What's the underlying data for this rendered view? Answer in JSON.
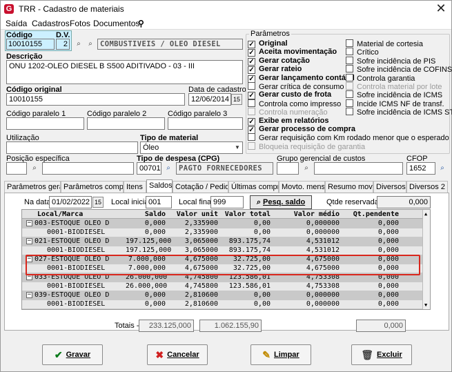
{
  "window": {
    "title": "TRR - Cadastro de materiais"
  },
  "menu": [
    "Saída",
    "Cadastros",
    "Fotos",
    "Documentos"
  ],
  "fields": {
    "codigo_label": "Código",
    "dv_label": "D.V.",
    "codigo": "10010155",
    "dv": "2",
    "grupo": "COMBUSTIVEIS / OLEO DIESEL",
    "descricao_label": "Descrição",
    "descricao": "ONU 1202-OLEO DIESEL B S500 ADITIVADO - 03 - III",
    "codigo_original_label": "Código original",
    "codigo_original": "10010155",
    "data_cadastro_label": "Data de cadastro",
    "data_cadastro": "12/06/2014",
    "cod_par1_label": "Código paralelo 1",
    "cod_par2_label": "Código paralelo 2",
    "cod_par3_label": "Código paralelo 3",
    "utilizacao_label": "Utilização",
    "tipo_material_label": "Tipo de material",
    "tipo_material": "Óleo",
    "posicao_label": "Posição específica",
    "tipo_despesa_label": "Tipo de despesa (CPG)",
    "tipo_despesa_code": "00701",
    "tipo_despesa_desc": "PAGTO FORNECEDORES",
    "grupo_custos_label": "Grupo gerencial de custos",
    "cfop_label": "CFOP",
    "cfop": "1652"
  },
  "params": {
    "legend": "Parâmetros",
    "left": [
      {
        "label": "Original",
        "checked": true,
        "disabled": false
      },
      {
        "label": "Aceita movimentação",
        "checked": true,
        "disabled": false
      },
      {
        "label": "Gerar cotação",
        "checked": true,
        "disabled": false
      },
      {
        "label": "Gerar rateio",
        "checked": true,
        "disabled": false
      },
      {
        "label": "Gerar lançamento contábil",
        "checked": true,
        "disabled": false
      },
      {
        "label": "Gerar crítica de consumo",
        "checked": false,
        "disabled": false
      },
      {
        "label": "Gerar custo de frota",
        "checked": true,
        "disabled": false
      },
      {
        "label": "Controla como impresso",
        "checked": false,
        "disabled": false
      },
      {
        "label": "Controla numeração",
        "checked": false,
        "disabled": true
      },
      {
        "label": "Exibe em relatórios",
        "checked": true,
        "disabled": false
      },
      {
        "label": "Gerar processo de compra",
        "checked": true,
        "disabled": false
      },
      {
        "label": "Gerar requisição com Km rodado menor que o esperado",
        "checked": false,
        "disabled": false
      },
      {
        "label": "Bloqueia requisição de garantia",
        "checked": false,
        "disabled": true
      }
    ],
    "right": [
      {
        "label": "Material de cortesia",
        "checked": false,
        "disabled": false
      },
      {
        "label": "Crítico",
        "checked": false,
        "disabled": false
      },
      {
        "label": "Sofre incidência de PIS",
        "checked": false,
        "disabled": false
      },
      {
        "label": "Sofre incidência de COFINS",
        "checked": false,
        "disabled": false
      },
      {
        "label": "Controla garantia",
        "checked": false,
        "disabled": false
      },
      {
        "label": "Controla material por lote",
        "checked": false,
        "disabled": true
      },
      {
        "label": "Sofre incidência de ICMS",
        "checked": false,
        "disabled": false
      },
      {
        "label": "Incide ICMS NF de transf.",
        "checked": false,
        "disabled": false
      },
      {
        "label": "Sofre incidência de ICMS ST",
        "checked": false,
        "disabled": false
      }
    ]
  },
  "tabs": [
    "Parâmetros gerais",
    "Parâmetros compras",
    "Itens",
    "Saldos",
    "Cotação / Pedido",
    "Últimas compras",
    "Movto. mensal",
    "Resumo movto.",
    "Diversos",
    "Diversos 2"
  ],
  "active_tab": 3,
  "saldos": {
    "na_data_label": "Na data",
    "na_data": "01/02/2022",
    "local_inicial_label": "Local inicial",
    "local_inicial": "001",
    "local_final_label": "Local final",
    "local_final": "999",
    "pesq_label": "Pesq. saldo",
    "qtde_reservada_label": "Qtde reservada ->",
    "qtde_reservada": "0,000",
    "columns": [
      "Local/Marca",
      "Saldo",
      "Valor unit",
      "Valor total",
      "Valor médio",
      "Qt.pendente"
    ],
    "rows": [
      {
        "type": "group",
        "name": "003-ESTOQUE OLEO D",
        "saldo": "0,000",
        "unit": "2,335900",
        "total": "0,00",
        "medio": "0,000000",
        "pend": "0,000"
      },
      {
        "type": "sub",
        "name": "0001-BIODIESEL",
        "saldo": "0,000",
        "unit": "2,335900",
        "total": "0,00",
        "medio": "0,000000",
        "pend": "0,000"
      },
      {
        "type": "group",
        "name": "021-ESTOQUE OLEO D",
        "saldo": "197.125,000",
        "unit": "3,065000",
        "total": "893.175,74",
        "medio": "4,531012",
        "pend": "0,000"
      },
      {
        "type": "sub",
        "name": "0001-BIODIESEL",
        "saldo": "197.125,000",
        "unit": "3,065000",
        "total": "893.175,74",
        "medio": "4,531012",
        "pend": "0,000"
      },
      {
        "type": "group",
        "name": "027-ESTOQUE OLEO D",
        "saldo": "7.000,000",
        "unit": "4,675000",
        "total": "32.725,00",
        "medio": "4,675000",
        "pend": "0,000"
      },
      {
        "type": "sub",
        "name": "0001-BIODIESEL",
        "saldo": "7.000,000",
        "unit": "4,675000",
        "total": "32.725,00",
        "medio": "4,675000",
        "pend": "0,000"
      },
      {
        "type": "group",
        "name": "033-ESTOQUE OLEO D",
        "saldo": "26.000,000",
        "unit": "4,745800",
        "total": "123.586,01",
        "medio": "4,753308",
        "pend": "0,000"
      },
      {
        "type": "sub",
        "name": "0001-BIODIESEL",
        "saldo": "26.000,000",
        "unit": "4,745800",
        "total": "123.586,01",
        "medio": "4,753308",
        "pend": "0,000"
      },
      {
        "type": "group",
        "name": "039-ESTOQUE OLEO D",
        "saldo": "0,000",
        "unit": "2,810600",
        "total": "0,00",
        "medio": "0,000000",
        "pend": "0,000"
      },
      {
        "type": "sub",
        "name": "0001-BIODIESEL",
        "saldo": "0,000",
        "unit": "2,810600",
        "total": "0,00",
        "medio": "0,000000",
        "pend": "0,000"
      }
    ],
    "totais_label": "Totais ->",
    "total_saldo": "233.125,000",
    "total_valor": "1.062.155,90",
    "total_pend": "0,000"
  },
  "buttons": {
    "gravar": "Gravar",
    "cancelar": "Cancelar",
    "limpar": "Limpar",
    "excluir": "Excluir"
  },
  "colors": {
    "highlight": "#d9261c",
    "code_bg": "#ccf0ff"
  }
}
